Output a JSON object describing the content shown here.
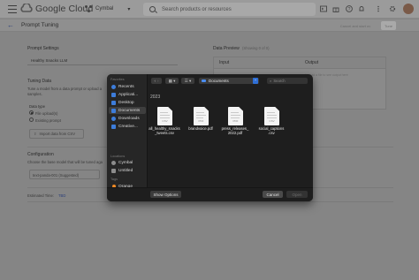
{
  "header": {
    "logo_text": "Google Cloud",
    "project_name": "Cymbal",
    "search_placeholder": "Search products or resources"
  },
  "subheader": {
    "title": "Prompt Tuning",
    "cancel_label": "Cancel and start ov",
    "save_label": "Tune"
  },
  "left": {
    "settings_label": "Prompt Settings",
    "name_value": "Healthy Snacks LLM",
    "tuning_data_label": "Tuning Data",
    "tuning_desc_1": "Tune a model from a data prompt or upload a",
    "tuning_desc_2": "samples.",
    "data_type_label": "Data type",
    "option_file": "File upload(s)",
    "option_existing": "Existing prompt",
    "import_label": "Import data from CSV",
    "config_label": "Configuration",
    "config_desc": "Choose the base model that will be tuned aga",
    "model_value": "text-panda-001 (Suggested)",
    "tokens_label": "Estimated Time:",
    "tokens_value": "TBD"
  },
  "preview": {
    "title": "Data Preview",
    "subtitle": "(Showing 0 of 0)",
    "col_input": "Input",
    "col_output": "Output",
    "output_hint": "Upload a file to see output here"
  },
  "dialog": {
    "favorites_label": "Favorites",
    "locations_label": "Locations",
    "tags_label": "Tags",
    "favorites": [
      "Recents",
      "Applicati...",
      "Desktop",
      "Documents",
      "Downloads",
      "Creative..."
    ],
    "selected_favorite": "Documents",
    "locations": [
      "Cymbal",
      "Untitled"
    ],
    "tags": [
      {
        "name": "Orange",
        "color": "#f08a24"
      },
      {
        "name": "Red",
        "color": "#e0443e"
      },
      {
        "name": "Yellow",
        "color": "#e8c23a"
      }
    ],
    "path_label": "Documents",
    "search_placeholder": "Search",
    "year_group": "2023",
    "files": [
      {
        "name_1": "all_healthy_snacks",
        "name_2": "_tweets.csv",
        "type": "CSV"
      },
      {
        "name_1": "brandvoice.pdf",
        "name_2": "",
        "type": "PDF"
      },
      {
        "name_1": "press_releases_",
        "name_2": "2022.pdf",
        "type": "PDF"
      },
      {
        "name_1": "social_captions",
        "name_2": ".csv",
        "type": "CSV"
      }
    ],
    "show_options_label": "Show Options",
    "cancel_label": "Cancel",
    "open_label": "Open"
  },
  "colors": {
    "dialog_bg": "#1e1e1e",
    "accent_blue": "#2f6fd6",
    "overlay_gray": "#858585"
  }
}
